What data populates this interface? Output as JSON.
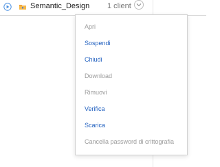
{
  "row": {
    "title": "Semantic_Design",
    "client_count": "1 client"
  },
  "menu": {
    "items": [
      {
        "label": "Apri",
        "enabled": false
      },
      {
        "label": "Sospendi",
        "enabled": true
      },
      {
        "label": "Chiudi",
        "enabled": true
      },
      {
        "label": "Download",
        "enabled": false
      },
      {
        "label": "Rimuovi",
        "enabled": false
      },
      {
        "label": "Verifica",
        "enabled": true
      },
      {
        "label": "Scarica",
        "enabled": true
      },
      {
        "label": "Cancella password di crittografia",
        "enabled": false
      }
    ]
  },
  "colors": {
    "enabled": "#1f5fbf",
    "disabled": "#9a9a9a",
    "play_icon": "#4a90e2",
    "folder_icon": "#f0a030"
  },
  "icons": {
    "play": "play-circle-icon",
    "folder": "folder-icon",
    "chevron": "chevron-down-icon"
  }
}
